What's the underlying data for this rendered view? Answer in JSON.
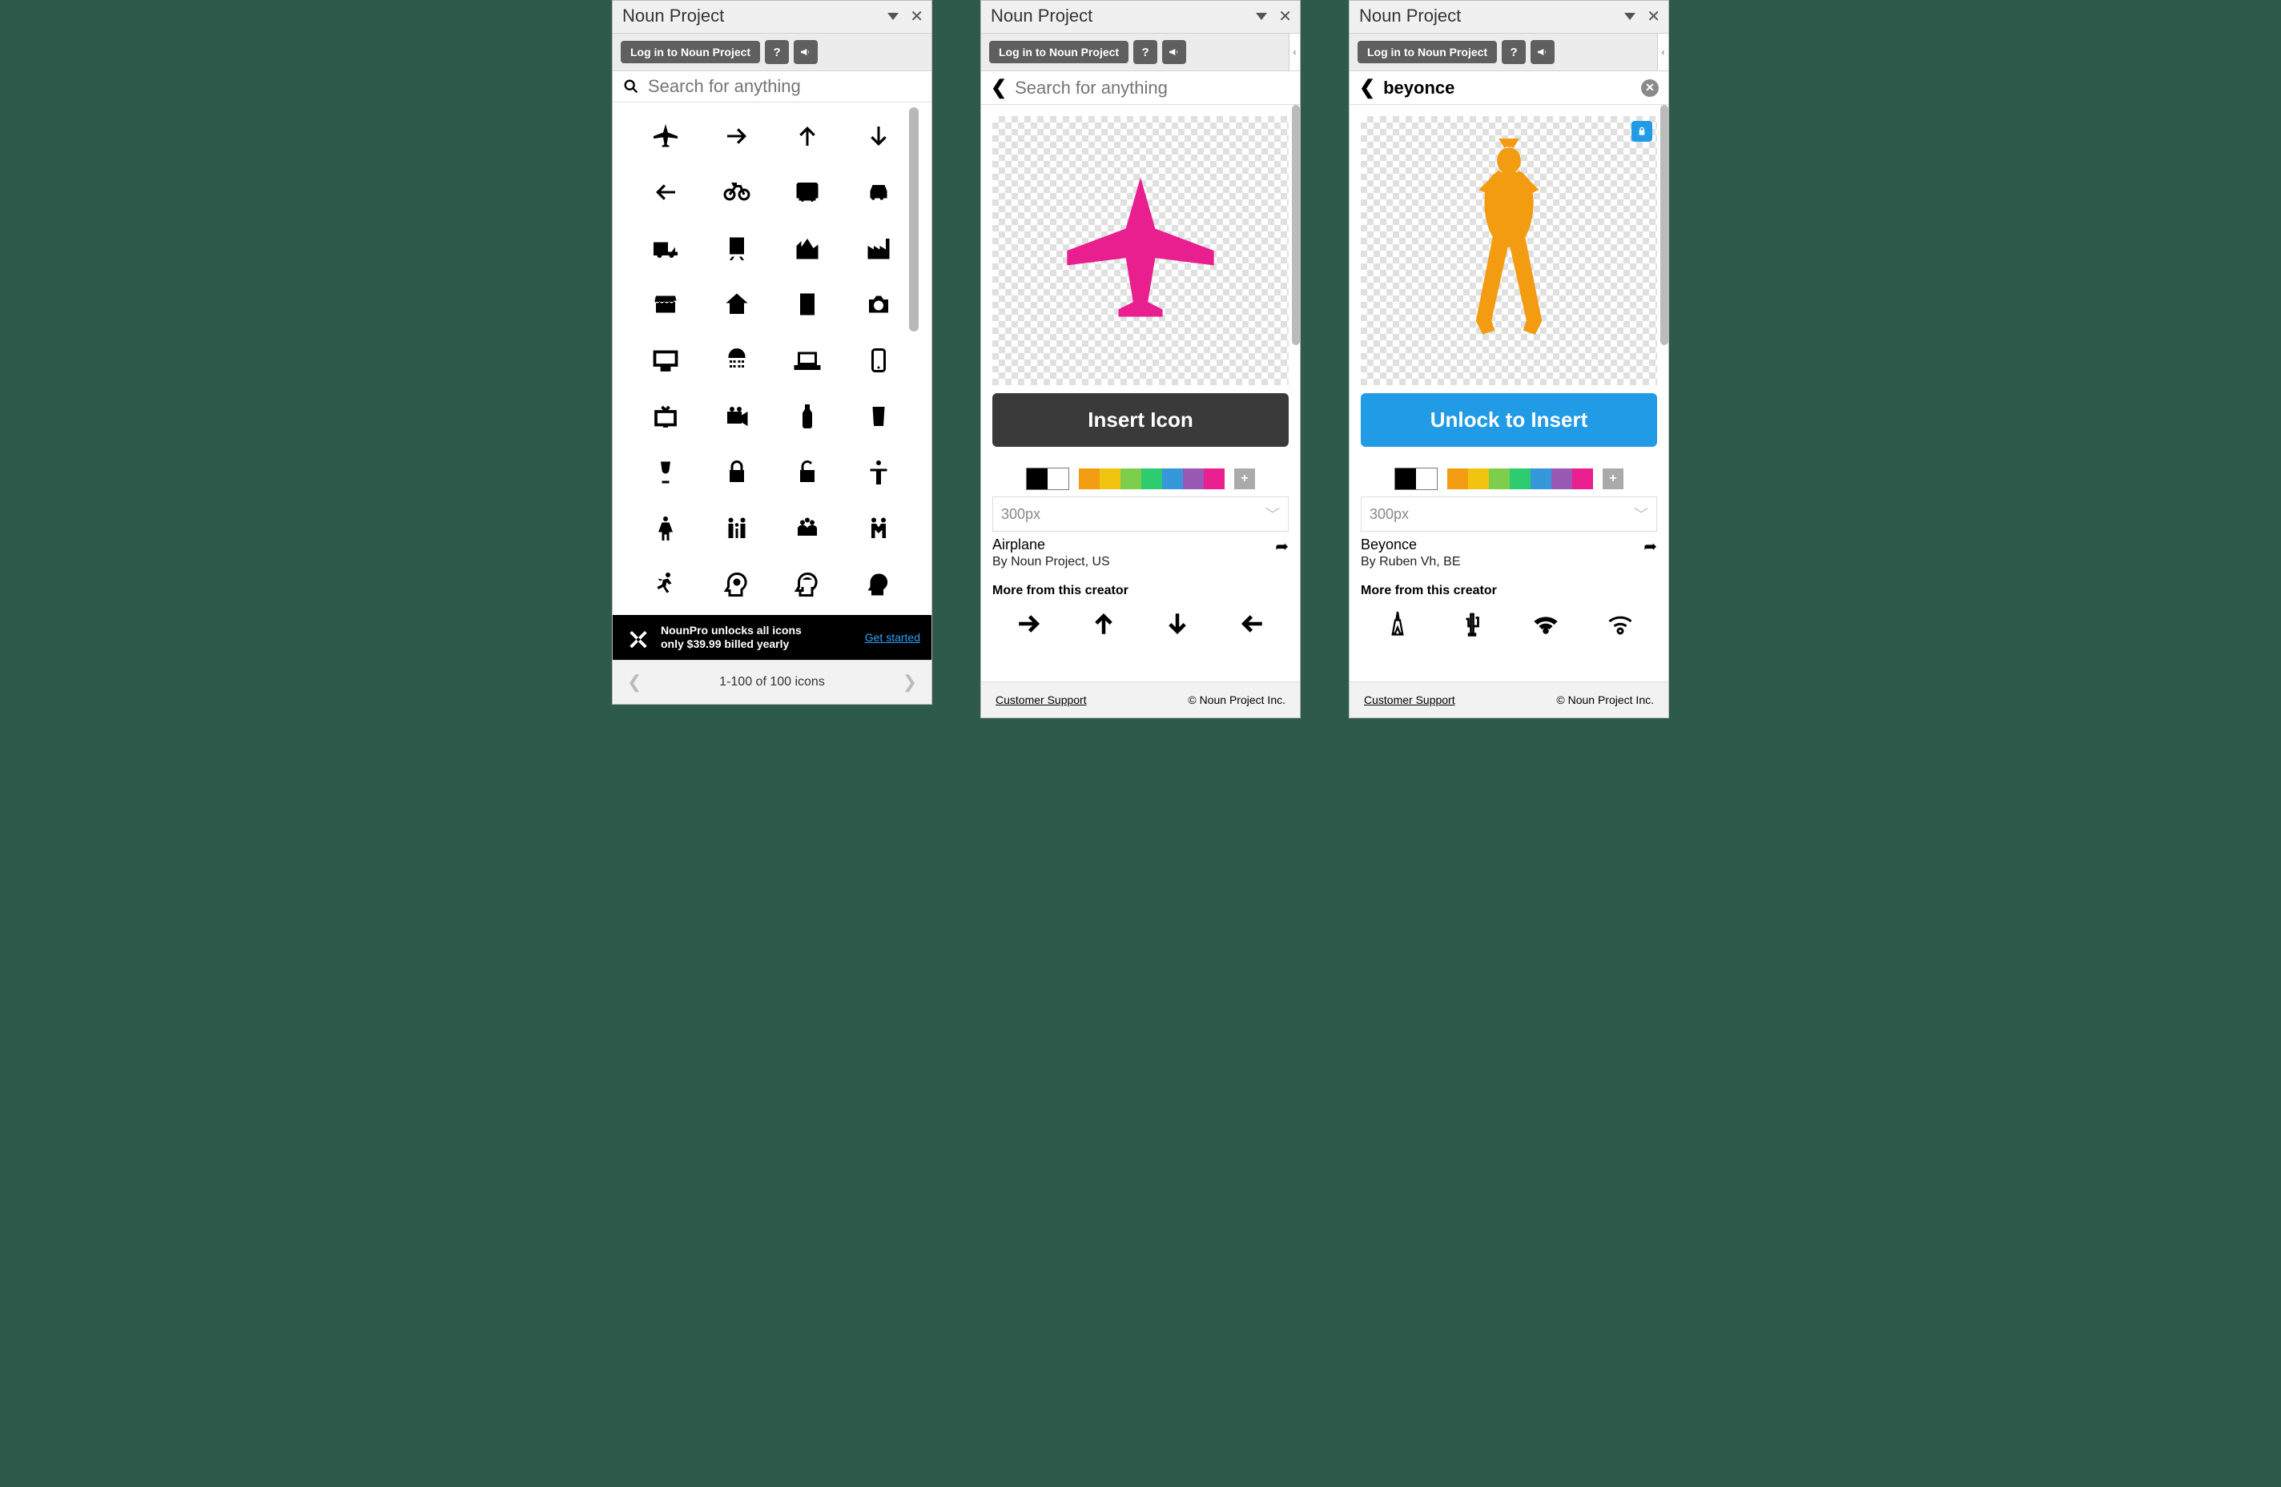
{
  "app_title": "Noun Project",
  "toolbar": {
    "login_label": "Log in to Noun Project",
    "help_glyph": "?",
    "announce_glyph": "📣"
  },
  "search": {
    "placeholder": "Search for anything"
  },
  "grid": {
    "icons": [
      "airplane",
      "arrow-right",
      "arrow-up",
      "arrow-down",
      "arrow-left",
      "bicycle",
      "bus",
      "car",
      "truck",
      "train",
      "city",
      "factory",
      "store",
      "house",
      "office",
      "camera",
      "monitor",
      "shower",
      "laptop",
      "phone",
      "tv",
      "video-camera",
      "bottle",
      "glass",
      "wine",
      "lock-closed",
      "lock-open",
      "person-stand",
      "woman",
      "family",
      "group",
      "handshake",
      "running",
      "head-think",
      "headphones",
      "head"
    ],
    "pager": "1-100 of 100 icons"
  },
  "promo": {
    "line1": "NounPro unlocks all icons",
    "line2": "only $39.99 billed yearly",
    "cta": "Get started"
  },
  "detail_airplane": {
    "insert_label": "Insert Icon",
    "size": "300px",
    "title": "Airplane",
    "by": "By Noun Project, US",
    "more_label": "More from this creator",
    "more_icons": [
      "arrow-right",
      "arrow-up",
      "arrow-down",
      "arrow-left"
    ],
    "footer_support": "Customer Support",
    "footer_copy": "© Noun Project Inc."
  },
  "detail_beyonce": {
    "search_value": "beyonce",
    "unlock_label": "Unlock to Insert",
    "size": "300px",
    "title": "Beyonce",
    "by": "By Ruben Vh, BE",
    "more_label": "More from this creator",
    "more_icons": [
      "eiffel",
      "cactus",
      "wifi-solid",
      "wifi-outline"
    ],
    "footer_support": "Customer Support",
    "footer_copy": "© Noun Project Inc."
  },
  "colors": {
    "black": "#000000",
    "white": "#ffffff",
    "strip": [
      "#f39c12",
      "#f1c40f",
      "#7dce4a",
      "#2ecc71",
      "#3498db",
      "#9b59b6",
      "#e91e8f"
    ],
    "airplane": "#e91e8f",
    "beyonce": "#f39c12"
  }
}
